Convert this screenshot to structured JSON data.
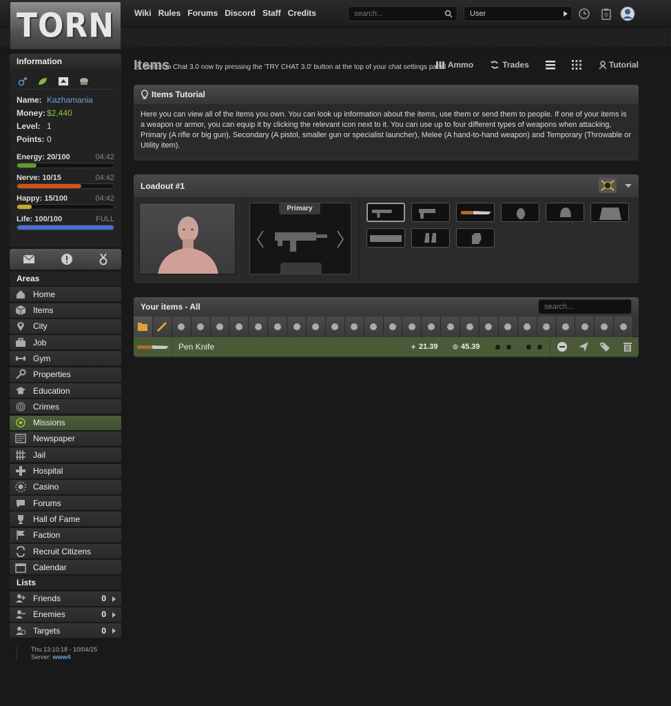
{
  "header": {
    "logo_text": "TORN",
    "nav": [
      "Wiki",
      "Rules",
      "Forums",
      "Discord",
      "Staff",
      "Credits"
    ],
    "search_placeholder": "search...",
    "user_dropdown": "User",
    "announcement": "Switch to Chat 3.0 now by pressing the 'TRY CHAT 3.0' button at the top of your chat settings panel"
  },
  "sidebar": {
    "info_title": "Information",
    "name_label": "Name:",
    "name_value": "Kazhamania",
    "money_label": "Money:",
    "money_value": "$2,440",
    "level_label": "Level:",
    "level_value": "1",
    "points_label": "Points:",
    "points_value": "0",
    "bars": [
      {
        "label": "Energy:",
        "value": "20/100",
        "timer": "04:42",
        "fraction": 0.2,
        "color": "#5a9e2b"
      },
      {
        "label": "Nerve:",
        "value": "10/15",
        "timer": "04:42",
        "fraction": 0.6667,
        "color": "#d3541c"
      },
      {
        "label": "Happy:",
        "value": "15/100",
        "timer": "04:42",
        "fraction": 0.15,
        "color": "#c9a72c"
      },
      {
        "label": "Life:",
        "value": "100/100",
        "timer": "FULL",
        "fraction": 1.0,
        "color": "#4a6fd6"
      }
    ],
    "areas_title": "Areas",
    "areas": [
      {
        "label": "Home",
        "icon": "house-icon"
      },
      {
        "label": "Items",
        "icon": "box-icon"
      },
      {
        "label": "City",
        "icon": "map-pin-icon"
      },
      {
        "label": "Job",
        "icon": "briefcase-icon"
      },
      {
        "label": "Gym",
        "icon": "dumbbell-icon"
      },
      {
        "label": "Properties",
        "icon": "key-icon"
      },
      {
        "label": "Education",
        "icon": "graduation-cap-icon"
      },
      {
        "label": "Crimes",
        "icon": "fingerprint-icon"
      },
      {
        "label": "Missions",
        "icon": "target-icon"
      },
      {
        "label": "Newspaper",
        "icon": "newspaper-icon"
      },
      {
        "label": "Jail",
        "icon": "bars-icon"
      },
      {
        "label": "Hospital",
        "icon": "cross-icon"
      },
      {
        "label": "Casino",
        "icon": "chip-icon"
      },
      {
        "label": "Forums",
        "icon": "chat-icon"
      },
      {
        "label": "Hall of Fame",
        "icon": "trophy-icon"
      },
      {
        "label": "Faction",
        "icon": "flag-icon"
      },
      {
        "label": "Recruit Citizens",
        "icon": "refresh-icon"
      },
      {
        "label": "Calendar",
        "icon": "calendar-icon"
      }
    ],
    "lists_title": "Lists",
    "lists": [
      {
        "label": "Friends",
        "count": "0"
      },
      {
        "label": "Enemies",
        "count": "0"
      },
      {
        "label": "Targets",
        "count": "0"
      }
    ],
    "footer_time": "Thu 13:10:18 - 10/04/25",
    "footer_server_label": "Server:",
    "footer_server": "www4"
  },
  "main": {
    "title": "Items",
    "links": {
      "ammo": "Ammo",
      "trades": "Trades",
      "tutorial": "Tutorial"
    },
    "tutorial_title": "Items Tutorial",
    "tutorial_text": "Here you can view all of the items you own. You can look up information about the items, use them or send them to people. If one of your items is a weapon or armor, you can equip it by clicking the relevant icon next to it. You can use up to four different types of weapons when attacking, Primary (A rifle or big gun), Secondary (A pistol, smaller gun or specialist launcher), Melee (A hand-to-hand weapon) and Temporary (Throwable or Utility item).",
    "loadout_title": "Loadout #1",
    "primary_label": "Primary",
    "your_items_title": "Your items",
    "your_items_filter": "All",
    "items_search_placeholder": "search...",
    "items": [
      {
        "name": "Pen Knife",
        "damage": "21.39",
        "accuracy": "45.39"
      }
    ]
  }
}
